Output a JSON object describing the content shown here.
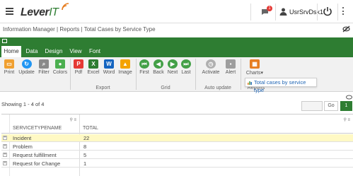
{
  "header": {
    "logo_main": "Lever",
    "logo_accent": "IT",
    "notification_count": "1",
    "user": "UsrSrvDsk1"
  },
  "breadcrumb": "Information Manager | Reports | Total Cases by Service Type",
  "tabs": [
    "Home",
    "Data",
    "Design",
    "View",
    "Font"
  ],
  "ribbon": {
    "buttons": [
      {
        "label": "Print",
        "icon": "print-icon",
        "color": "#f0a030"
      },
      {
        "label": "Update",
        "icon": "refresh-icon",
        "color": "#2196f3"
      },
      {
        "label": "Filter",
        "icon": "filter-icon",
        "color": "#8a8a8a"
      },
      {
        "label": "Colors",
        "icon": "palette-icon",
        "color": "#4caf50"
      },
      {
        "label": "Pdf",
        "icon": "pdf-icon",
        "color": "#e53935"
      },
      {
        "label": "Excel",
        "icon": "excel-icon",
        "color": "#2e7d32"
      },
      {
        "label": "Word",
        "icon": "word-icon",
        "color": "#1565c0"
      },
      {
        "label": "Image",
        "icon": "image-icon",
        "color": "#f4a300"
      },
      {
        "label": "First",
        "icon": "first-icon",
        "color": "#43a047"
      },
      {
        "label": "Back",
        "icon": "back-icon",
        "color": "#43a047"
      },
      {
        "label": "Next",
        "icon": "next-icon",
        "color": "#43a047"
      },
      {
        "label": "Last",
        "icon": "last-icon",
        "color": "#43a047"
      },
      {
        "label": "Activate",
        "icon": "clock-icon",
        "color": "#b0b0b0"
      },
      {
        "label": "Alert",
        "icon": "alert-icon",
        "color": "#9e9e9e"
      },
      {
        "label": "Charts▾",
        "icon": "charts-icon",
        "color": "#e67e22"
      }
    ],
    "groups": [
      "Export",
      "Grid",
      "Auto update",
      "Reports"
    ]
  },
  "dropdown_item": "Total cases by service type",
  "showing": "Showing 1 - 4 of 4",
  "pager": {
    "go": "Go",
    "current": "1"
  },
  "table": {
    "columns": [
      "SERVICETYPENAME",
      "TOTAL"
    ],
    "rows": [
      {
        "name": "Incident",
        "total": "22"
      },
      {
        "name": "Problem",
        "total": "8"
      },
      {
        "name": "Request fulfillment",
        "total": "5"
      },
      {
        "name": "Request for Change",
        "total": "1"
      }
    ]
  },
  "colors": {
    "brand_green": "#2e7d32",
    "selected_row": "#fff9c4",
    "link_blue": "#1e64b4"
  }
}
